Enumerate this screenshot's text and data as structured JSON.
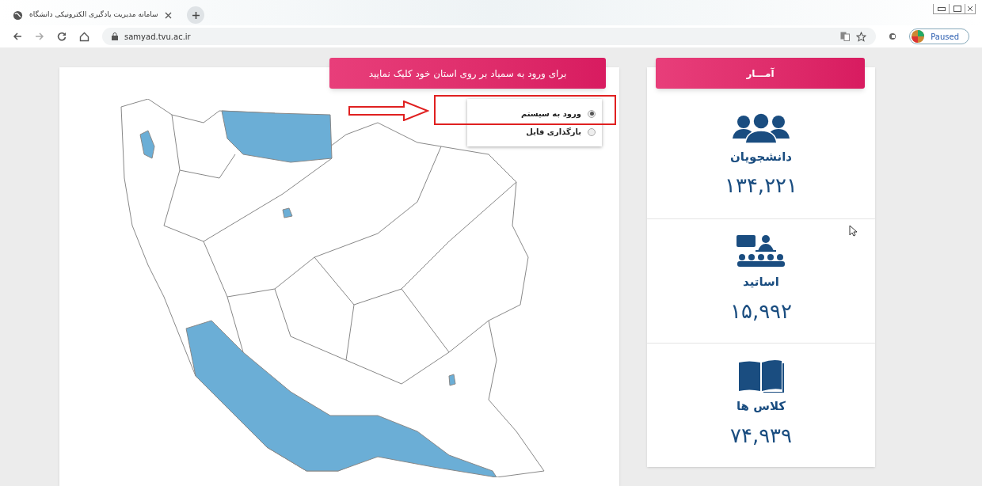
{
  "browser": {
    "tab_title": "سامانه مدیریت یادگیری الکترونیکی دانشگاه",
    "url": "samyad.tvu.ac.ir",
    "profile_label": "Paused"
  },
  "map_panel": {
    "header": "برای ورود به سمیاد بر روی استان خود کلیک نمایید",
    "options": [
      {
        "label": "ورود به سیستم",
        "selected": true
      },
      {
        "label": "بارگذاری فایل",
        "selected": false
      }
    ]
  },
  "stats": {
    "title": "آمـــار",
    "items": [
      {
        "kind": "students",
        "label": "دانشجویان",
        "value": "۱۳۴,۲۲۱"
      },
      {
        "kind": "teachers",
        "label": "اساتید",
        "value": "۱۵,۹۹۲"
      },
      {
        "kind": "classes",
        "label": "کلاس ها",
        "value": "۷۴,۹۳۹"
      }
    ]
  }
}
